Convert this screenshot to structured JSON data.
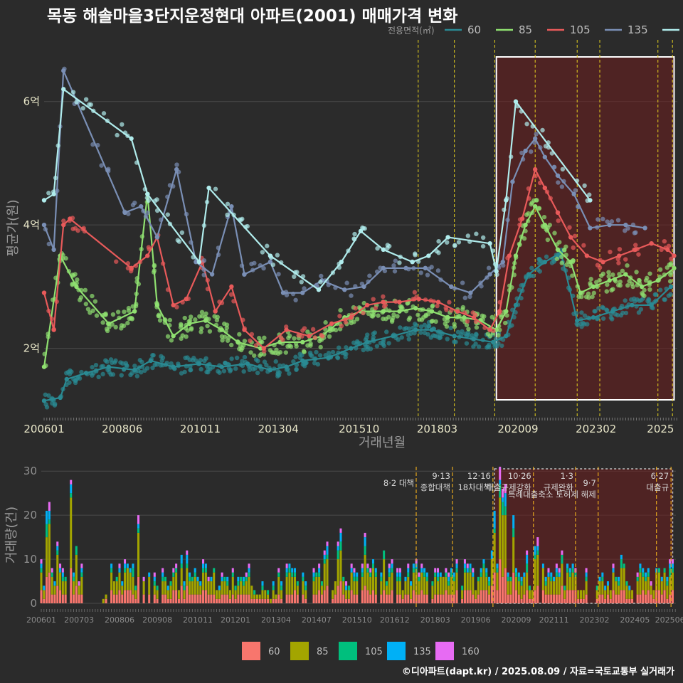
{
  "title": "목동 해솔마을3단지운정현대 아파트(2001) 매매가격 변화",
  "legend": {
    "heading": "전용면적(㎡)",
    "items": [
      {
        "label": "60",
        "line_color": "#2a8a93",
        "bar_color": "#f8766d"
      },
      {
        "label": "85",
        "line_color": "#8fe070",
        "bar_color": "#a3a500"
      },
      {
        "label": "105",
        "line_color": "#e85a5a",
        "bar_color": "#00bf7d"
      },
      {
        "label": "135",
        "line_color": "#7a8fb5",
        "bar_color": "#00b0f6"
      },
      {
        "label": "160",
        "line_color": "#b0ecec",
        "bar_color": "#e76bf3"
      }
    ]
  },
  "footer": "©디아파트(dapt.kr) / 2025.08.09 / 자료=국토교통부 실거래가",
  "chart_data": [
    {
      "type": "line",
      "ylabel": "평균가(원)",
      "xlabel": "거래년월",
      "x_ticks": [
        "200601",
        "200806",
        "201011",
        "201304",
        "201510",
        "201803",
        "202009",
        "202302",
        "2025"
      ],
      "y_ticks": [
        "2억",
        "4억",
        "6억"
      ],
      "y_tick_values": [
        2,
        4,
        6
      ],
      "y_unit": "억",
      "ylim": [
        0.9,
        7.0
      ],
      "xlim": [
        2006.0,
        2025.6
      ],
      "grid": true,
      "highlight_box": [
        2020.0,
        2025.5
      ],
      "policy_lines": [
        2017.58,
        2018.7,
        2019.95,
        2021.2,
        2022.5,
        2023.2,
        2025.0,
        2025.45
      ],
      "series": [
        {
          "name": "60",
          "points": [
            [
              2006.0,
              1.15
            ],
            [
              2006.5,
              1.2
            ],
            [
              2006.7,
              1.5
            ],
            [
              2007.3,
              1.6
            ],
            [
              2008.0,
              1.7
            ],
            [
              2008.8,
              1.65
            ],
            [
              2009.3,
              1.8
            ],
            [
              2010.0,
              1.7
            ],
            [
              2010.8,
              1.75
            ],
            [
              2011.5,
              1.7
            ],
            [
              2012.3,
              1.75
            ],
            [
              2013.0,
              1.65
            ],
            [
              2013.5,
              1.7
            ],
            [
              2014.0,
              1.8
            ],
            [
              2014.8,
              1.85
            ],
            [
              2015.5,
              2.0
            ],
            [
              2016.0,
              2.1
            ],
            [
              2016.8,
              2.2
            ],
            [
              2017.5,
              2.3
            ],
            [
              2018.0,
              2.3
            ],
            [
              2018.7,
              2.2
            ],
            [
              2019.3,
              2.15
            ],
            [
              2019.9,
              2.1
            ],
            [
              2020.3,
              2.2
            ],
            [
              2020.6,
              2.7
            ],
            [
              2021.0,
              3.2
            ],
            [
              2021.5,
              3.4
            ],
            [
              2022.0,
              3.55
            ],
            [
              2022.5,
              2.45
            ],
            [
              2023.0,
              2.5
            ],
            [
              2023.6,
              2.6
            ],
            [
              2024.2,
              2.7
            ],
            [
              2024.8,
              2.7
            ],
            [
              2025.4,
              3.0
            ]
          ]
        },
        {
          "name": "85",
          "points": [
            [
              2006.0,
              1.7
            ],
            [
              2006.5,
              3.5
            ],
            [
              2007.0,
              3.0
            ],
            [
              2008.0,
              2.4
            ],
            [
              2008.8,
              2.6
            ],
            [
              2009.2,
              4.5
            ],
            [
              2009.5,
              2.7
            ],
            [
              2010.0,
              2.2
            ],
            [
              2010.5,
              2.4
            ],
            [
              2011.0,
              2.45
            ],
            [
              2011.5,
              2.3
            ],
            [
              2012.0,
              2.1
            ],
            [
              2012.7,
              2.0
            ],
            [
              2013.3,
              2.1
            ],
            [
              2014.0,
              2.1
            ],
            [
              2014.6,
              2.2
            ],
            [
              2015.3,
              2.5
            ],
            [
              2015.8,
              2.6
            ],
            [
              2016.5,
              2.6
            ],
            [
              2017.0,
              2.6
            ],
            [
              2017.5,
              2.65
            ],
            [
              2018.0,
              2.6
            ],
            [
              2018.5,
              2.5
            ],
            [
              2019.0,
              2.5
            ],
            [
              2019.5,
              2.45
            ],
            [
              2020.0,
              2.3
            ],
            [
              2020.3,
              2.6
            ],
            [
              2020.6,
              3.5
            ],
            [
              2020.9,
              4.0
            ],
            [
              2021.2,
              4.3
            ],
            [
              2021.5,
              4.0
            ],
            [
              2021.9,
              3.6
            ],
            [
              2022.3,
              3.4
            ],
            [
              2022.6,
              2.9
            ],
            [
              2023.0,
              3.0
            ],
            [
              2023.5,
              3.1
            ],
            [
              2024.0,
              3.2
            ],
            [
              2024.5,
              3.0
            ],
            [
              2025.0,
              3.1
            ],
            [
              2025.5,
              3.3
            ]
          ]
        },
        {
          "name": "105",
          "points": [
            [
              2006.0,
              2.9
            ],
            [
              2006.3,
              2.3
            ],
            [
              2006.6,
              4.0
            ],
            [
              2006.8,
              4.1
            ],
            [
              2008.7,
              3.3
            ],
            [
              2009.2,
              3.5
            ],
            [
              2009.5,
              3.8
            ],
            [
              2010.0,
              2.7
            ],
            [
              2010.4,
              2.8
            ],
            [
              2010.9,
              3.4
            ],
            [
              2011.3,
              2.6
            ],
            [
              2011.8,
              3.0
            ],
            [
              2012.2,
              2.3
            ],
            [
              2012.8,
              2.0
            ],
            [
              2013.5,
              2.3
            ],
            [
              2014.2,
              2.2
            ],
            [
              2014.9,
              2.4
            ],
            [
              2015.5,
              2.5
            ],
            [
              2016.0,
              2.7
            ],
            [
              2016.5,
              2.75
            ],
            [
              2017.0,
              2.75
            ],
            [
              2017.6,
              2.8
            ],
            [
              2018.2,
              2.75
            ],
            [
              2018.8,
              2.6
            ],
            [
              2019.3,
              2.5
            ],
            [
              2019.8,
              2.3
            ],
            [
              2020.1,
              2.6
            ],
            [
              2020.4,
              3.5
            ],
            [
              2020.8,
              4.1
            ],
            [
              2021.2,
              4.9
            ],
            [
              2021.5,
              4.6
            ],
            [
              2021.9,
              4.2
            ],
            [
              2022.3,
              3.8
            ],
            [
              2022.8,
              3.5
            ],
            [
              2023.3,
              3.4
            ],
            [
              2023.8,
              3.5
            ],
            [
              2024.3,
              3.6
            ],
            [
              2024.8,
              3.7
            ],
            [
              2025.3,
              3.6
            ],
            [
              2025.5,
              3.5
            ]
          ]
        },
        {
          "name": "135",
          "points": [
            [
              2006.0,
              4.0
            ],
            [
              2006.3,
              3.6
            ],
            [
              2006.6,
              6.5
            ],
            [
              2008.5,
              4.2
            ],
            [
              2009.0,
              4.3
            ],
            [
              2009.5,
              3.8
            ],
            [
              2010.1,
              4.9
            ],
            [
              2010.7,
              3.4
            ],
            [
              2011.2,
              3.2
            ],
            [
              2011.8,
              4.3
            ],
            [
              2012.2,
              3.2
            ],
            [
              2013.0,
              3.4
            ],
            [
              2013.4,
              2.9
            ],
            [
              2014.0,
              2.9
            ],
            [
              2014.6,
              3.1
            ],
            [
              2015.3,
              2.95
            ],
            [
              2015.9,
              3.0
            ],
            [
              2016.5,
              3.3
            ],
            [
              2017.2,
              3.3
            ],
            [
              2017.8,
              3.3
            ],
            [
              2018.6,
              3.0
            ],
            [
              2019.2,
              2.9
            ],
            [
              2019.8,
              3.2
            ],
            [
              2020.2,
              3.4
            ],
            [
              2020.5,
              4.7
            ],
            [
              2020.9,
              5.2
            ],
            [
              2021.2,
              5.4
            ],
            [
              2021.5,
              5.1
            ],
            [
              2021.9,
              4.8
            ],
            [
              2022.4,
              4.5
            ],
            [
              2022.9,
              3.95
            ],
            [
              2023.5,
              4.0
            ],
            [
              2024.0,
              4.0
            ],
            [
              2024.6,
              3.95
            ]
          ]
        },
        {
          "name": "160",
          "points": [
            [
              2006.0,
              4.4
            ],
            [
              2006.3,
              4.5
            ],
            [
              2006.6,
              6.2
            ],
            [
              2008.7,
              5.4
            ],
            [
              2009.2,
              4.5
            ],
            [
              2010.8,
              3.4
            ],
            [
              2011.1,
              4.6
            ],
            [
              2013.0,
              3.5
            ],
            [
              2014.5,
              2.95
            ],
            [
              2015.2,
              3.4
            ],
            [
              2015.8,
              3.9
            ],
            [
              2016.5,
              3.6
            ],
            [
              2017.4,
              3.4
            ],
            [
              2017.9,
              3.5
            ],
            [
              2018.5,
              3.8
            ],
            [
              2019.8,
              3.7
            ],
            [
              2020.0,
              3.25
            ],
            [
              2020.3,
              4.4
            ],
            [
              2020.6,
              6.0
            ],
            [
              2022.9,
              4.4
            ]
          ]
        }
      ]
    },
    {
      "type": "bar",
      "stacked": true,
      "ylabel": "거래량(건)",
      "x_ticks": [
        "200601",
        "200703",
        "200806",
        "200908",
        "201011",
        "201201",
        "201304",
        "201407",
        "201510",
        "201612",
        "201803",
        "201906",
        "202009",
        "202111",
        "202302",
        "202405",
        "202506"
      ],
      "y_ticks": [
        "0",
        "10",
        "20",
        "30"
      ],
      "y_tick_values": [
        0,
        10,
        20,
        30
      ],
      "ylim": [
        0,
        31
      ],
      "xlim": [
        2006.0,
        2025.6
      ],
      "highlight_box": [
        2020.0,
        2025.5
      ],
      "series_names": [
        "60",
        "85",
        "105",
        "135",
        "160"
      ],
      "policy_lines": [
        {
          "x": 2017.58,
          "label": "8·2 대책",
          "row": 1
        },
        {
          "x": 2018.7,
          "label": "9·13\n종합대책",
          "row": 0
        },
        {
          "x": 2019.95,
          "label": "12·16\n18차대책",
          "row": 0
        },
        {
          "x": 2021.2,
          "label": "10·26\n대출규제강화",
          "row": 0
        },
        {
          "x": 2022.5,
          "label": "1·3\n규제완화",
          "row": 0
        },
        {
          "x": 2023.2,
          "label": "9·7\n특례대출축소 토허제 해제",
          "row": 1
        },
        {
          "x": 2025.0,
          "label": "",
          "row": 0
        },
        {
          "x": 2025.45,
          "label": "6·27\n대출규",
          "row": 0
        }
      ],
      "peaks": [
        [
          2006.2,
          23
        ],
        [
          2006.5,
          15
        ],
        [
          2006.9,
          30
        ],
        [
          2007.1,
          14
        ],
        [
          2008.2,
          8
        ],
        [
          2009.0,
          22
        ],
        [
          2009.4,
          17
        ],
        [
          2014.8,
          13
        ],
        [
          2015.2,
          16
        ],
        [
          2016.0,
          15
        ],
        [
          2016.6,
          14
        ],
        [
          2017.6,
          11
        ],
        [
          2019.5,
          8
        ],
        [
          2019.9,
          13
        ],
        [
          2020.0,
          22
        ],
        [
          2020.2,
          28
        ],
        [
          2020.35,
          24
        ],
        [
          2020.6,
          18
        ],
        [
          2021.3,
          14
        ],
        [
          2022.1,
          11
        ],
        [
          2023.9,
          10
        ],
        [
          2024.6,
          8
        ],
        [
          2025.5,
          8
        ]
      ]
    }
  ]
}
